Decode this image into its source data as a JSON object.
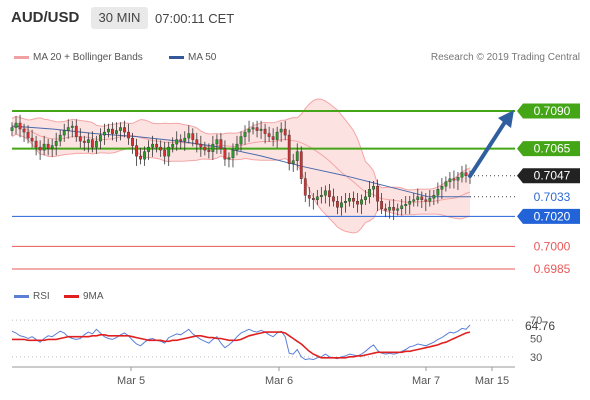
{
  "header": {
    "pair": "AUD/USD",
    "timeframe": "30 MIN",
    "time": "07:00:11 CET"
  },
  "legend": {
    "bb_label": "MA 20 + Bollinger Bands",
    "ma50_label": "MA 50",
    "research": "Research © 2019 Trading Central"
  },
  "rsi_legend": {
    "rsi_label": "RSI",
    "ma_label": "9MA"
  },
  "colors": {
    "green_level": "#44a616",
    "blue_level": "#2263d8",
    "red_level": "#e75a5a",
    "current_price": "#222222",
    "arrow": "#2f5f9e",
    "candle_up": "#2a9a2a",
    "candle_down": "#d83030",
    "bollinger": "#f4a5a5",
    "ma50": "#4a6aaa",
    "rsi": "#5b7fd6",
    "rsi_ma": "#e02020"
  },
  "chart_data": [
    {
      "type": "candlestick",
      "x_tick_labels": [
        "Mar 5",
        "Mar 6",
        "Mar 7",
        "Mar 15"
      ],
      "levels": [
        {
          "value": "0.7090",
          "kind": "resistance",
          "color": "green"
        },
        {
          "value": "0.7065",
          "kind": "resistance",
          "color": "green"
        },
        {
          "value": "0.7047",
          "kind": "current_price",
          "color": "dark"
        },
        {
          "value": "0.7033",
          "kind": "reference",
          "color": "none"
        },
        {
          "value": "0.7020",
          "kind": "pivot",
          "color": "blue"
        },
        {
          "value": "0.7000",
          "kind": "support",
          "color": "red"
        },
        {
          "value": "0.6985",
          "kind": "support",
          "color": "red"
        }
      ],
      "ylim": [
        0.6975,
        0.711
      ],
      "closes": [
        0.7079,
        0.7082,
        0.7078,
        0.7076,
        0.7072,
        0.707,
        0.7066,
        0.7064,
        0.7068,
        0.7065,
        0.7067,
        0.707,
        0.7074,
        0.7077,
        0.7079,
        0.708,
        0.7073,
        0.707,
        0.7069,
        0.7071,
        0.7066,
        0.707,
        0.7074,
        0.7076,
        0.7078,
        0.7075,
        0.7077,
        0.7079,
        0.7076,
        0.7072,
        0.7067,
        0.706,
        0.7058,
        0.7063,
        0.7066,
        0.7068,
        0.7066,
        0.7064,
        0.706,
        0.7066,
        0.7068,
        0.7071,
        0.707,
        0.7072,
        0.7075,
        0.7071,
        0.7068,
        0.7066,
        0.7064,
        0.7063,
        0.7068,
        0.7071,
        0.7065,
        0.7058,
        0.7059,
        0.7064,
        0.7068,
        0.7073,
        0.7076,
        0.7078,
        0.7079,
        0.7077,
        0.7078,
        0.7075,
        0.7073,
        0.7071,
        0.7076,
        0.7078,
        0.7074,
        0.7055,
        0.7057,
        0.7063,
        0.7045,
        0.7034,
        0.7032,
        0.7031,
        0.7033,
        0.7034,
        0.7037,
        0.7033,
        0.703,
        0.7026,
        0.7029,
        0.703,
        0.7032,
        0.703,
        0.7028,
        0.7031,
        0.7033,
        0.7038,
        0.704,
        0.703,
        0.7025,
        0.7024,
        0.7026,
        0.7024,
        0.7025,
        0.7027,
        0.7028,
        0.703,
        0.7031,
        0.7033,
        0.7031,
        0.703,
        0.7032,
        0.7034,
        0.7038,
        0.704,
        0.7043,
        0.7045,
        0.7044,
        0.7046,
        0.7049,
        0.7047,
        0.7047
      ],
      "ma50_anchor_points": [
        0.708,
        0.7078,
        0.7075,
        0.7073,
        0.707,
        0.7066,
        0.706,
        0.7053,
        0.7047,
        0.704,
        0.7033,
        0.7033
      ]
    },
    {
      "type": "line",
      "name": "RSI",
      "ylim": [
        20,
        80
      ],
      "y_tick_labels": [
        "70",
        "50",
        "30"
      ],
      "last_value": "64.76",
      "series": [
        {
          "name": "RSI",
          "values": [
            58,
            56,
            53,
            52,
            50,
            52,
            49,
            46,
            50,
            53,
            52,
            55,
            58,
            56,
            52,
            50,
            49,
            50,
            54,
            57,
            55,
            60,
            56,
            52,
            50,
            49,
            51,
            54,
            56,
            53,
            48,
            44,
            42,
            46,
            49,
            50,
            48,
            47,
            45,
            51,
            53,
            55,
            54,
            57,
            60,
            55,
            52,
            49,
            47,
            45,
            49,
            52,
            45,
            40,
            43,
            47,
            52,
            56,
            58,
            60,
            58,
            57,
            59,
            57,
            54,
            52,
            56,
            58,
            52,
            34,
            33,
            38,
            30,
            27,
            28,
            27,
            29,
            30,
            33,
            30,
            29,
            28,
            30,
            31,
            33,
            32,
            31,
            33,
            36,
            40,
            43,
            37,
            34,
            33,
            34,
            33,
            34,
            36,
            38,
            41,
            42,
            44,
            43,
            42,
            44,
            46,
            49,
            51,
            54,
            57,
            56,
            58,
            61,
            60,
            64.76
          ]
        },
        {
          "name": "9MA",
          "values": [
            49,
            49,
            49,
            49,
            48,
            48,
            48,
            48,
            48,
            49,
            49,
            49,
            50,
            51,
            52,
            52,
            52,
            52,
            52,
            52,
            53,
            53,
            54,
            54,
            53,
            53,
            53,
            53,
            53,
            53,
            52,
            51,
            50,
            49,
            48,
            48,
            48,
            48,
            47,
            47,
            48,
            48,
            49,
            50,
            51,
            52,
            53,
            53,
            52,
            51,
            51,
            50,
            50,
            49,
            48,
            48,
            48,
            49,
            51,
            53,
            54,
            55,
            56,
            57,
            57,
            57,
            57,
            57,
            56,
            53,
            50,
            47,
            44,
            40,
            36,
            33,
            31,
            29,
            29,
            29,
            29,
            29,
            29,
            29,
            30,
            30,
            31,
            31,
            32,
            33,
            34,
            35,
            35,
            35,
            35,
            35,
            35,
            35,
            36,
            36,
            37,
            38,
            39,
            40,
            41,
            42,
            43,
            45,
            46,
            48,
            50,
            52,
            54,
            56,
            57
          ]
        }
      ]
    }
  ]
}
